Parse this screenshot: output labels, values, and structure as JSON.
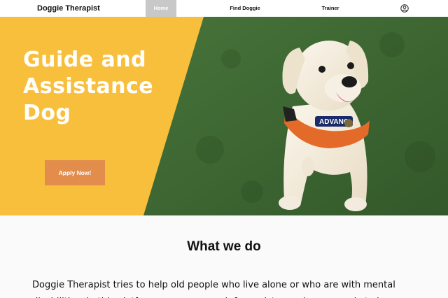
{
  "header": {
    "brand": "Doggie Therapist",
    "nav": [
      {
        "label": "Home",
        "active": true
      },
      {
        "label": "Find Doggie"
      },
      {
        "label": "Trainer"
      }
    ],
    "account_icon": "user-circle-icon"
  },
  "hero": {
    "title": "Guide and Assistance Dog",
    "cta": "Apply Now!",
    "vest_text": "ADVANC",
    "colors": {
      "panel": "#f7bf3c",
      "cta": "#e28d4b",
      "grass": "#3f6b32"
    }
  },
  "section": {
    "title": "What we do",
    "body": "Doggie Therapist tries to help old people who live alone or who are with mental disabilities. In this platform, you can search for assistance dogs or apply to become a"
  }
}
